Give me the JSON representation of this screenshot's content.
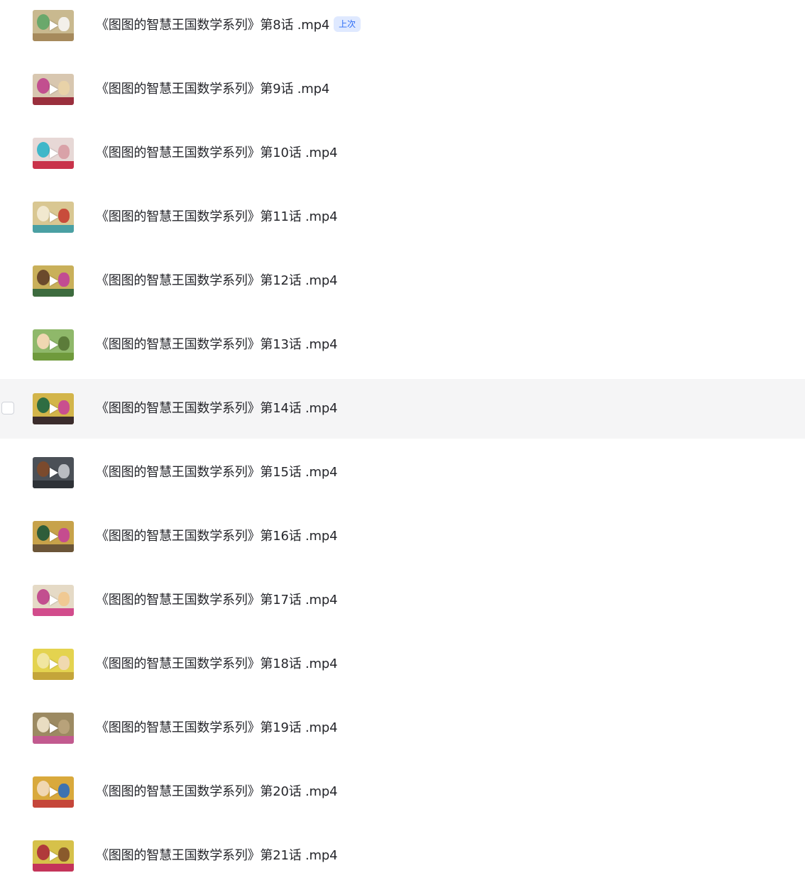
{
  "colors": {
    "hover_row_bg": "#f5f5f6",
    "text": "#25262b",
    "badge_bg": "#dfe9ff",
    "badge_text": "#2d6df6"
  },
  "icons": {
    "play": "play-icon",
    "thumbnail": "video-thumbnail"
  },
  "files": [
    {
      "name": "《图图的智慧王国数学系列》第8话 .mp4",
      "badge": "上次"
    },
    {
      "name": "《图图的智慧王国数学系列》第9话 .mp4"
    },
    {
      "name": "《图图的智慧王国数学系列》第10话 .mp4"
    },
    {
      "name": "《图图的智慧王国数学系列》第11话 .mp4"
    },
    {
      "name": "《图图的智慧王国数学系列》第12话 .mp4"
    },
    {
      "name": "《图图的智慧王国数学系列》第13话 .mp4"
    },
    {
      "name": "《图图的智慧王国数学系列》第14话 .mp4"
    },
    {
      "name": "《图图的智慧王国数学系列》第15话 .mp4"
    },
    {
      "name": "《图图的智慧王国数学系列》第16话 .mp4"
    },
    {
      "name": "《图图的智慧王国数学系列》第17话 .mp4"
    },
    {
      "name": "《图图的智慧王国数学系列》第18话 .mp4"
    },
    {
      "name": "《图图的智慧王国数学系列》第19话 .mp4"
    },
    {
      "name": "《图图的智慧王国数学系列》第20话 .mp4"
    },
    {
      "name": "《图图的智慧王国数学系列》第21话 .mp4"
    }
  ]
}
